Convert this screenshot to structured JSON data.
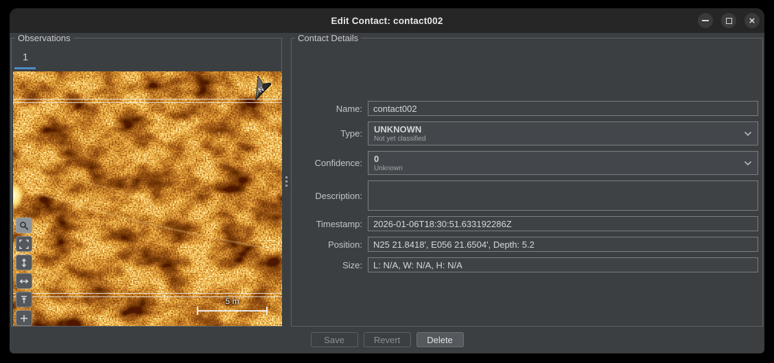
{
  "window": {
    "title": "Edit Contact: contact002",
    "controls": [
      {
        "name": "minimize",
        "icon": "minimize-icon"
      },
      {
        "name": "maximize",
        "icon": "maximize-icon"
      },
      {
        "name": "close",
        "icon": "close-icon"
      }
    ]
  },
  "observations": {
    "legend": "Observations",
    "tabs": [
      {
        "label": "1",
        "active": true
      }
    ],
    "image": {
      "north_label": "N",
      "scale_bar_label": "5 m",
      "tools": [
        {
          "name": "magnifier",
          "icon": "magnifier-icon",
          "active": true
        },
        {
          "name": "fit-view",
          "icon": "fit-view-icon",
          "active": false
        },
        {
          "name": "expand-vertical",
          "icon": "expand-vertical-icon",
          "active": false
        },
        {
          "name": "expand-horizontal",
          "icon": "expand-horizontal-icon",
          "active": false
        },
        {
          "name": "snap-top",
          "icon": "snap-top-icon",
          "active": false
        },
        {
          "name": "crosshair",
          "icon": "crosshair-icon",
          "active": false
        }
      ]
    }
  },
  "details": {
    "legend": "Contact Details",
    "fields": {
      "name": {
        "label": "Name:",
        "value": "contact002"
      },
      "type": {
        "label": "Type:",
        "value": "UNKNOWN",
        "description": "Not yet classified",
        "icon": "chevron-down-icon"
      },
      "confidence": {
        "label": "Confidence:",
        "value": "0",
        "description": "Unknown",
        "icon": "chevron-down-icon"
      },
      "description": {
        "label": "Description:",
        "value": ""
      },
      "timestamp": {
        "label": "Timestamp:",
        "value": "2026-01-06T18:30:51.633192286Z"
      },
      "position": {
        "label": "Position:",
        "value": "N25 21.8418', E056 21.6504', Depth: 5.2"
      },
      "size": {
        "label": "Size:",
        "value": "L: N/A, W: N/A, H: N/A"
      }
    }
  },
  "actions": {
    "save": "Save",
    "revert": "Revert",
    "delete": "Delete"
  },
  "colors": {
    "titlebar": "#262626",
    "window_bg": "#3b3f42",
    "group_border": "#5f6366",
    "input_bg": "#3e4245",
    "input_border": "#7b7f82",
    "tab_underline": "#4f8cc9",
    "sonar_orange": "#9c3e07",
    "scale_white": "#eeeeee",
    "delete_button_bg": "#55595d"
  }
}
